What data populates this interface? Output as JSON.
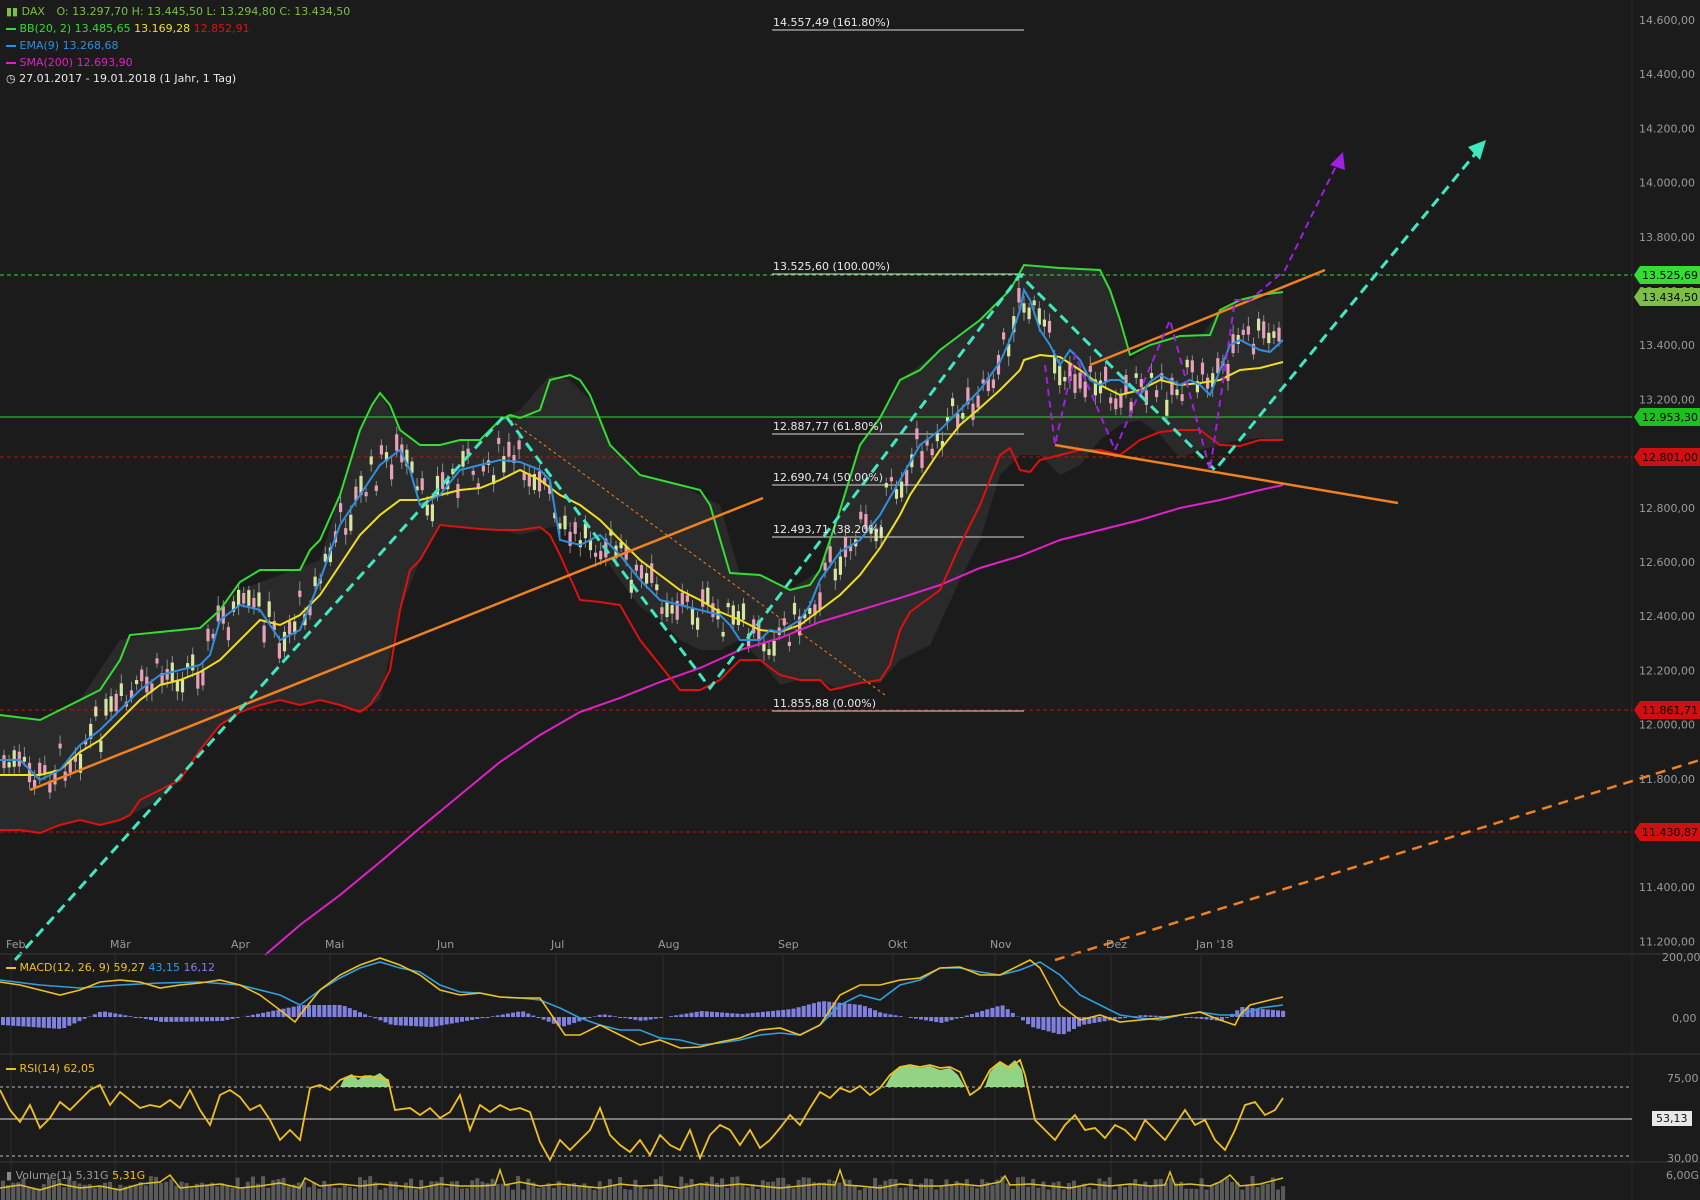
{
  "header": {
    "symbol": "DAX",
    "ohlc": "O: 13.297,70  H: 13.445,50  L: 13.294,80  C: 13.434,50",
    "bb_label": "BB(20, 2)",
    "bb_upper": "13.485,65",
    "bb_mid": "13.169,28",
    "bb_lower": "12.852,91",
    "ema_label": "EMA(9)",
    "ema_value": "13.268,68",
    "sma_label": "SMA(200)",
    "sma_value": "12.693,90",
    "range": "27.01.2017 - 19.01.2018",
    "period": "(1 Jahr, 1 Tag)"
  },
  "colors": {
    "background": "#1b1b1b",
    "bb_upper": "#33dd33",
    "bb_mid": "#f0e020",
    "bb_lower": "#e01010",
    "ema": "#2f8fdf",
    "sma": "#e020c8",
    "trend_orange": "#f08020",
    "trend_cyan": "#40e8c0",
    "trend_purple": "#a020e0",
    "macd_line": "#f0c020",
    "signal_line": "#2f9fdf",
    "histogram": "#8080e0",
    "rsi_line": "#f0c020",
    "rsi_fill": "#a0e890",
    "volume_line": "#e0c020"
  },
  "price_axis": {
    "ticks": [
      "14.600,00",
      "14.400,00",
      "14.200,00",
      "14.000,00",
      "13.800,00",
      "13.600,00",
      "13.400,00",
      "13.200,00",
      "13.000,00",
      "12.800,00",
      "12.600,00",
      "12.400,00",
      "12.200,00",
      "12.000,00",
      "11.800,00",
      "11.600,00",
      "11.400,00",
      "11.200,00"
    ],
    "tags": [
      {
        "label": "13.525,69",
        "color": "#33dd33"
      },
      {
        "label": "13.434,50",
        "color": "#7bc043"
      },
      {
        "label": "12.953,30",
        "color": "#1ec01e"
      },
      {
        "label": "12.801,00",
        "color": "#d01010"
      },
      {
        "label": "11.861,71",
        "color": "#d01010"
      },
      {
        "label": "11.430,87",
        "color": "#d01010"
      }
    ]
  },
  "time_axis": {
    "labels": [
      "Feb",
      "Mär",
      "Apr",
      "Mai",
      "Jun",
      "Jul",
      "Aug",
      "Sep",
      "Okt",
      "Nov",
      "Dez",
      "Jan '18"
    ]
  },
  "fibonacci": [
    {
      "label": "14.557,49 (161.80%)"
    },
    {
      "label": "13.525,60 (100.00%)"
    },
    {
      "label": "12.887,77 (61.80%)"
    },
    {
      "label": "12.690,74 (50.00%)"
    },
    {
      "label": "12.493,71 (38.20%)"
    },
    {
      "label": "11.855,88 (0.00%)"
    }
  ],
  "macd": {
    "label": "MACD(12, 26, 9)",
    "macd": "59,27",
    "signal": "43,15",
    "hist": "16,12",
    "ticks": [
      "200,00",
      "0,00"
    ]
  },
  "rsi": {
    "label": "RSI(14)",
    "value": "62,05",
    "ticks": [
      "75,00",
      "53,13",
      "30,00"
    ]
  },
  "volume": {
    "label": "Volume(1)",
    "v1": "5,31G",
    "v2": "5,31G",
    "tick": "6,00G"
  },
  "chart_data": {
    "type": "line",
    "title": "DAX",
    "x_range": [
      "27.01.2017",
      "19.01.2018"
    ],
    "ylim": [
      11100,
      14650
    ],
    "series": [
      {
        "name": "DAX close",
        "values": [
          11650,
          11700,
          11800,
          11830,
          11970,
          12040,
          12090,
          12150,
          12180,
          12230,
          12260,
          12330,
          12400,
          12650,
          12730,
          12770,
          12620,
          12680,
          12490,
          12550,
          12820,
          12420,
          12180,
          12140,
          12060,
          12070,
          12160,
          12280,
          12270,
          12130,
          12080,
          12240,
          12470,
          12590,
          12580,
          12780,
          12940,
          13010,
          13000,
          13120,
          13240,
          13450,
          13260,
          13020,
          13060,
          13080,
          12980,
          13150,
          13160,
          13200,
          12870,
          13240,
          13390,
          13230,
          13260,
          13430
        ]
      },
      {
        "name": "BB(20, 2)",
        "values": [
          11850,
          11900,
          12050,
          12120,
          12150,
          12250,
          12360,
          12400,
          12540,
          12720,
          12960,
          13000,
          12830,
          12840,
          12880,
          12890,
          12950,
          12930,
          12810,
          12650,
          12380,
          12350,
          12340,
          12300,
          12430,
          12600,
          12770,
          12880,
          13050,
          13290,
          13470,
          13490,
          13450,
          13200,
          13180,
          13240,
          13320,
          13330,
          13380,
          13420,
          13485
        ]
      },
      {
        "name": "EMA(9)",
        "values": [
          11600,
          11680,
          11760,
          11880,
          12020,
          12150,
          12220,
          12300,
          12460,
          12620,
          12720,
          12760,
          12700,
          12640,
          12580,
          12390,
          12230,
          12170,
          12140,
          12110,
          12120,
          12240,
          12390,
          12540,
          12760,
          12900,
          13040,
          13260,
          13320,
          13140,
          13080,
          13110,
          13080,
          13060,
          13090,
          13060,
          13100,
          13250,
          13330,
          13240,
          13269
        ]
      },
      {
        "name": "SMA(200)",
        "values": [
          11060,
          11180,
          11330,
          11500,
          11690,
          11860,
          11990,
          12090,
          12190,
          12290,
          12390,
          12470,
          12550,
          12630,
          12694
        ]
      }
    ]
  }
}
